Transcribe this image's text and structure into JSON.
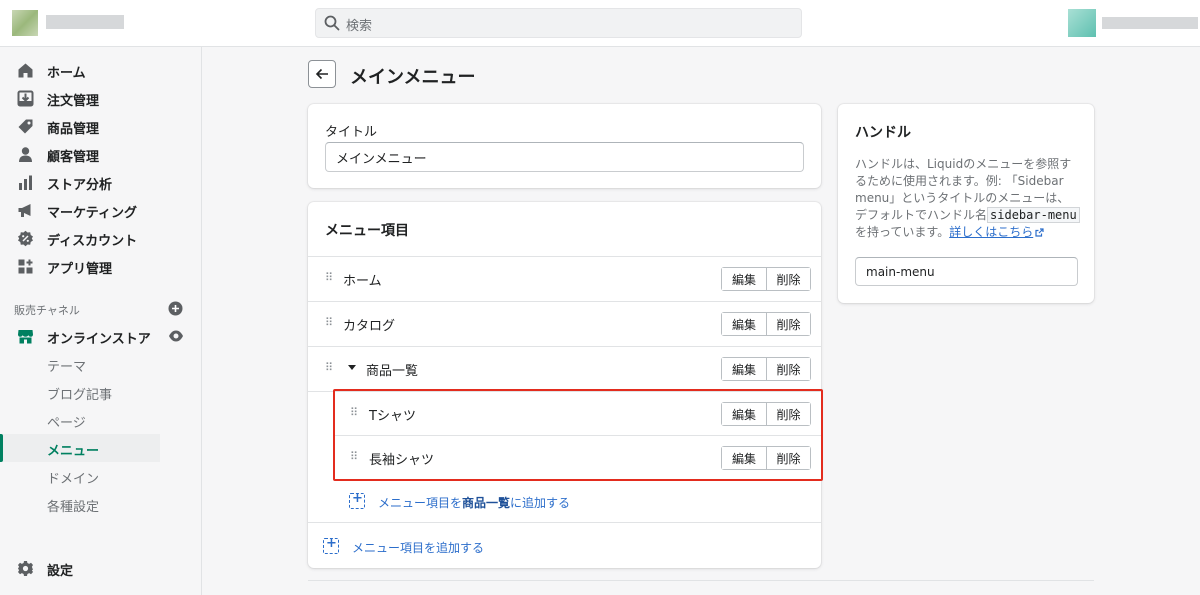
{
  "topbar": {
    "search": {
      "placeholder": "検索"
    }
  },
  "sidebar": {
    "items": [
      {
        "label": "ホーム",
        "icon": "home-icon"
      },
      {
        "label": "注文管理",
        "icon": "orders-icon"
      },
      {
        "label": "商品管理",
        "icon": "tag-icon"
      },
      {
        "label": "顧客管理",
        "icon": "person-icon"
      },
      {
        "label": "ストア分析",
        "icon": "bar-chart-icon"
      },
      {
        "label": "マーケティング",
        "icon": "megaphone-icon"
      },
      {
        "label": "ディスカウント",
        "icon": "discount-icon"
      },
      {
        "label": "アプリ管理",
        "icon": "apps-icon"
      }
    ],
    "channels_label": "販売チャネル",
    "online_store": {
      "label": "オンラインストア",
      "sub_items": [
        "テーマ",
        "ブログ記事",
        "ページ",
        "メニュー",
        "ドメイン",
        "各種設定"
      ],
      "active": "メニュー"
    },
    "settings_label": "設定"
  },
  "page": {
    "title": "メインメニュー",
    "title_card": {
      "label": "タイトル",
      "value": "メインメニュー"
    },
    "menu_card": {
      "header": "メニュー項目",
      "rows": [
        {
          "label": "ホーム",
          "level": 0
        },
        {
          "label": "カタログ",
          "level": 0
        },
        {
          "label": "商品一覧",
          "level": 0,
          "expanded": true
        },
        {
          "label": "Tシャツ",
          "level": 1
        },
        {
          "label": "長袖シャツ",
          "level": 1
        }
      ],
      "edit_label": "編集",
      "delete_label": "削除",
      "add_child_prefix": "メニュー項目を",
      "add_child_target": "商品一覧",
      "add_child_suffix": "に追加する",
      "add_item_label": "メニュー項目を追加する"
    },
    "handle_card": {
      "title": "ハンドル",
      "desc_1": "ハンドルは、Liquidのメニューを参照するために使用されます。例: 「Sidebar menu」というタイトルのメニューは、デフォルトでハンドル名",
      "desc_code": "sidebar-menu",
      "desc_2": "を持っています。",
      "learn_more": "詳しくはこちら",
      "value": "main-menu"
    }
  },
  "colors": {
    "accent_green": "#008060",
    "link_blue": "#2c6ecb",
    "highlight_red": "#e32c1e"
  }
}
